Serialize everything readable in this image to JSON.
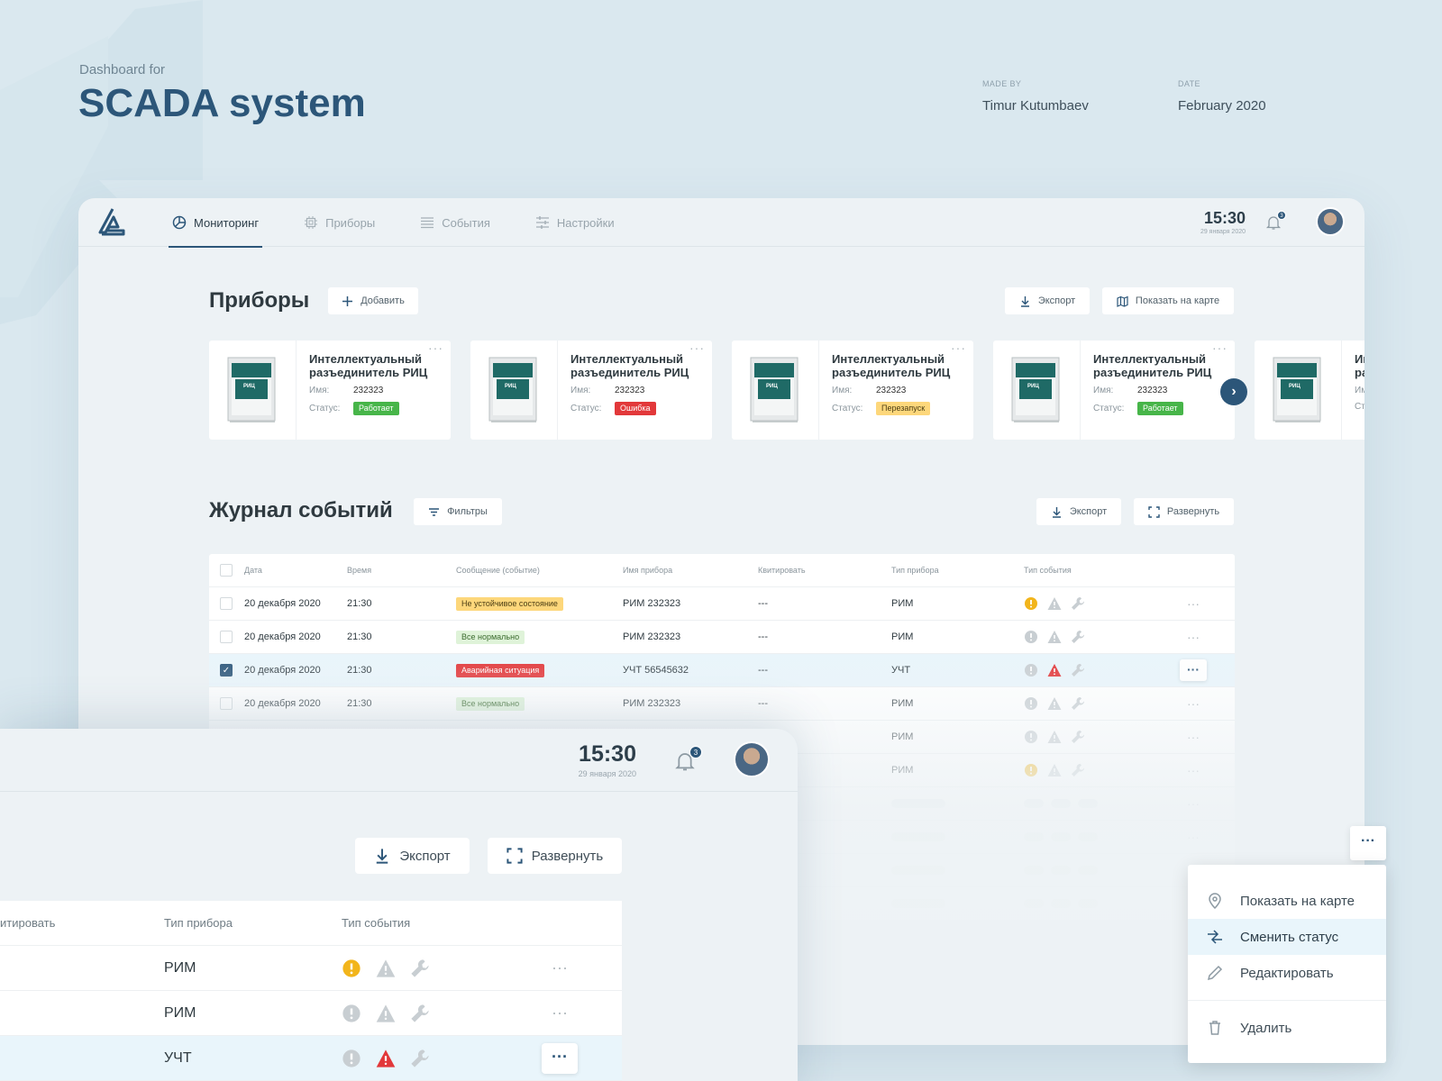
{
  "header": {
    "subtitle": "Dashboard for",
    "title": "SCADA system",
    "made_by_label": "MADE BY",
    "made_by": "Timur Kutumbaev",
    "date_label": "DATE",
    "date": "February 2020"
  },
  "nav": {
    "items": [
      {
        "label": "Мониторинг",
        "icon": "monitoring-icon"
      },
      {
        "label": "Приборы",
        "icon": "chip-icon"
      },
      {
        "label": "События",
        "icon": "list-icon"
      },
      {
        "label": "Настройки",
        "icon": "sliders-icon"
      }
    ],
    "active": 0
  },
  "status": {
    "time": "15:30",
    "date": "29 января 2020",
    "notifications": "3"
  },
  "devices": {
    "title": "Приборы",
    "add_label": "Добавить",
    "export_label": "Экспорт",
    "map_label": "Показать на карте",
    "name_label": "Имя:",
    "status_label": "Статус:",
    "cards": [
      {
        "name": "Интеллектуальный разъединитель РИЦ",
        "id": "232323",
        "status": "Работает",
        "kind": "ok"
      },
      {
        "name": "Интеллектуальный разъединитель РИЦ",
        "id": "232323",
        "status": "Ошибка",
        "kind": "err"
      },
      {
        "name": "Интеллектуальный разъединитель РИЦ",
        "id": "232323",
        "status": "Перезапуск",
        "kind": "rst"
      },
      {
        "name": "Интеллектуальный разъединитель РИЦ",
        "id": "232323",
        "status": "Работает",
        "kind": "ok"
      },
      {
        "name": "Интеллектуальный разъединитель РИЦ",
        "id": "",
        "status": "",
        "kind": ""
      }
    ],
    "device_label": "РИЦ"
  },
  "log": {
    "title": "Журнал событий",
    "filters_label": "Фильтры",
    "export_label": "Экспорт",
    "expand_label": "Развернуть",
    "columns": [
      "Дата",
      "Время",
      "Сообщение (событие)",
      "Имя прибора",
      "Квитировать",
      "Тип прибора",
      "Тип события"
    ],
    "rows": [
      {
        "date": "20 декабря 2020",
        "time": "21:30",
        "msg": "Не устойчивое состояние",
        "kind": "warn",
        "device": "РИМ 232323",
        "ack": "---",
        "type": "РИМ",
        "ev": "warn",
        "checked": false
      },
      {
        "date": "20 декабря 2020",
        "time": "21:30",
        "msg": "Все нормально",
        "kind": "norm",
        "device": "РИМ 232323",
        "ack": "---",
        "type": "РИМ",
        "ev": "none",
        "checked": false
      },
      {
        "date": "20 декабря 2020",
        "time": "21:30",
        "msg": "Аварийная ситуация",
        "kind": "alarm",
        "device": "УЧТ 56545632",
        "ack": "---",
        "type": "УЧТ",
        "ev": "alarm",
        "checked": true
      },
      {
        "date": "20 декабря 2020",
        "time": "21:30",
        "msg": "Все нормально",
        "kind": "norm",
        "device": "РИМ 232323",
        "ack": "---",
        "type": "РИМ",
        "ev": "none",
        "checked": false
      },
      {
        "date": "",
        "time": "",
        "msg": "",
        "kind": "",
        "device": "",
        "ack": "",
        "type": "РИМ",
        "ev": "none",
        "checked": false
      },
      {
        "date": "",
        "time": "",
        "msg": "",
        "kind": "",
        "device": "",
        "ack": "",
        "type": "РИМ",
        "ev": "warn",
        "checked": false
      }
    ],
    "skeleton_rows": 4,
    "more": "···"
  },
  "zoom": {
    "time": "15:30",
    "date": "29 января 2020",
    "notifications": "3",
    "export_label": "Экспорт",
    "expand_label": "Развернуть",
    "columns": [
      "итировать",
      "Тип прибора",
      "Тип события"
    ],
    "rows": [
      {
        "type": "РИМ",
        "ev": "warn"
      },
      {
        "type": "РИМ",
        "ev": "none"
      },
      {
        "type": "УЧТ",
        "ev": "alarm"
      }
    ]
  },
  "context_menu": {
    "items": [
      "Показать на карте",
      "Сменить статус",
      "Редактировать",
      "Удалить"
    ],
    "highlighted": 1
  },
  "colors": {
    "accent": "#2c5679",
    "ok": "#47b549",
    "error": "#e2383a",
    "warn": "#f2b51c"
  }
}
